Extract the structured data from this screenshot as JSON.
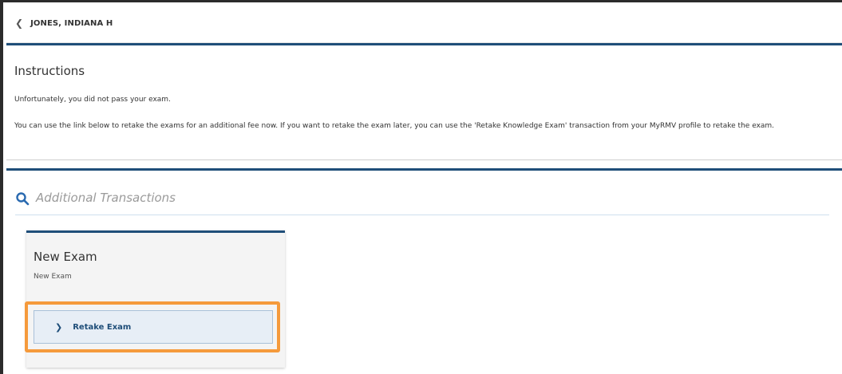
{
  "header": {
    "back_icon": "chevron-left-icon",
    "name": "JONES, INDIANA H"
  },
  "instructions": {
    "title": "Instructions",
    "line1": "Unfortunately, you did not pass your exam.",
    "line2": "You can use the link below to retake the exams for an additional fee now. If you want to retake the exam later, you can use the 'Retake Knowledge Exam' transaction from your MyRMV profile to retake the exam."
  },
  "additional": {
    "search_icon": "search-icon",
    "title": "Additional Transactions",
    "card": {
      "title": "New Exam",
      "subtitle": "New Exam",
      "action_icon": "chevron-right-icon",
      "action_label": "Retake Exam"
    }
  },
  "colors": {
    "accent_blue": "#1f4e79",
    "highlight_orange": "#f59a3c",
    "button_bg": "#e7eef6"
  }
}
